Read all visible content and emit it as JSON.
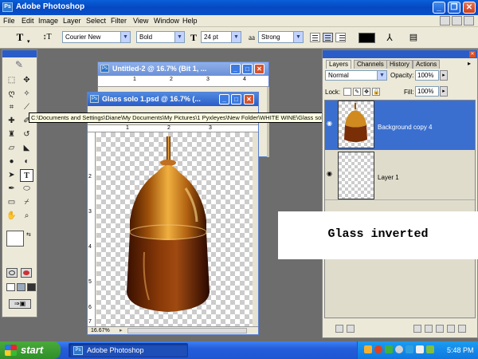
{
  "app": {
    "title": "Adobe Photoshop"
  },
  "menu": {
    "items": [
      "File",
      "Edit",
      "Image",
      "Layer",
      "Select",
      "Filter",
      "View",
      "Window",
      "Help"
    ]
  },
  "options": {
    "tool_glyph": "T",
    "font_family": "Courier New",
    "font_style": "Bold",
    "font_size": "24 pt",
    "antialias_glyph": "aa",
    "antialias": "Strong",
    "text_color": "#000000"
  },
  "windows": {
    "untitled": {
      "title": "Untitled-2 @ 16.7% (Bit 1, ..."
    },
    "main": {
      "title": "Glass solo 1.psd @ 16.7% (...",
      "zoom": "16.67%",
      "ruler_h": [
        "1",
        "2",
        "3"
      ],
      "ruler_v": [
        "2",
        "3",
        "4",
        "5",
        "6",
        "7"
      ]
    },
    "untitled_ruler": [
      "1",
      "2",
      "3",
      "4"
    ]
  },
  "tooltip": "C:\\Documents and Settings\\Diane\\My Documents\\My Pictures\\1 Pyxleyes\\New Folder\\WHITE WINE\\Glass solo 1.psd @ 16.7% (Background copy 4, RGB/8)",
  "layers_panel": {
    "tabs": [
      "Layers",
      "Channels",
      "History",
      "Actions"
    ],
    "blend_mode": "Normal",
    "opacity_label": "Opacity:",
    "opacity_value": "100%",
    "lock_label": "Lock:",
    "fill_label": "Fill:",
    "fill_value": "100%",
    "layers": [
      {
        "name": "Background copy 4",
        "selected": true
      },
      {
        "name": "Layer 1",
        "selected": false
      }
    ]
  },
  "caption": "Glass inverted",
  "taskbar": {
    "start": "start",
    "task": "Adobe Photoshop",
    "clock": "5:48 PM"
  },
  "colors": {
    "accent": "#3169c6",
    "selection": "#3a6fd0"
  }
}
